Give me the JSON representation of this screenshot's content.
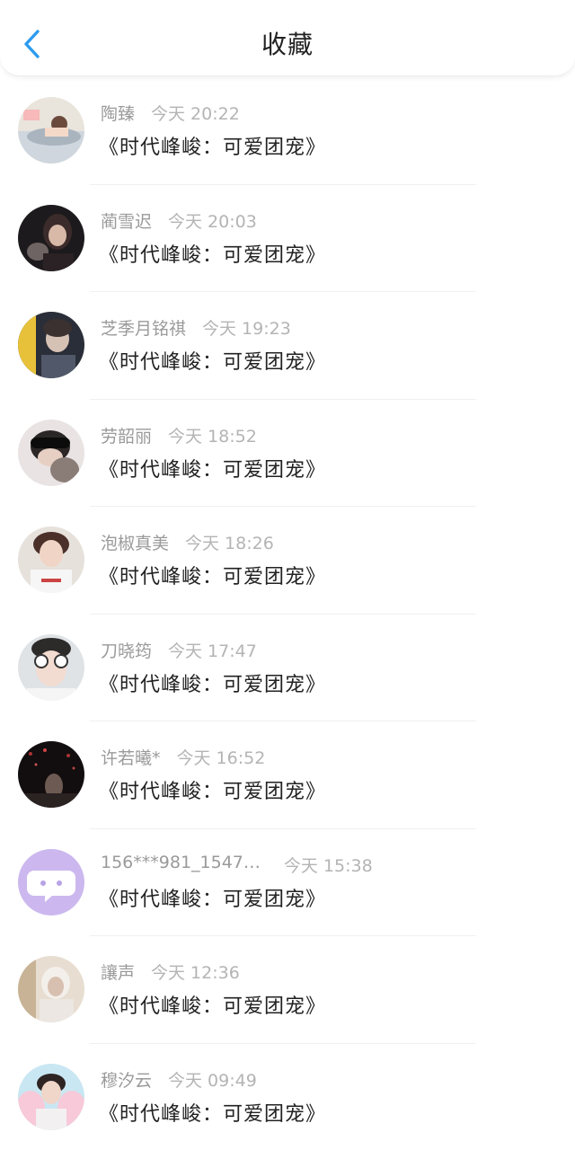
{
  "header": {
    "title": "收藏",
    "back_icon": "chevron-left-icon",
    "accent_color": "#2d9bf0"
  },
  "items": [
    {
      "name": "陶臻",
      "time": "今天 20:22",
      "book": "《时代峰峻：可爱团宠》"
    },
    {
      "name": "蔺雪迟",
      "time": "今天 20:03",
      "book": "《时代峰峻：可爱团宠》"
    },
    {
      "name": "芝季月铭祺",
      "time": "今天 19:23",
      "book": "《时代峰峻：可爱团宠》"
    },
    {
      "name": "劳韶丽",
      "time": "今天 18:52",
      "book": "《时代峰峻：可爱团宠》"
    },
    {
      "name": "泡椒真美",
      "time": "今天 18:26",
      "book": "《时代峰峻：可爱团宠》"
    },
    {
      "name": "刀晓筠",
      "time": "今天 17:47",
      "book": "《时代峰峻：可爱团宠》"
    },
    {
      "name": "许若曦*",
      "time": "今天 16:52",
      "book": "《时代峰峻：可爱团宠》"
    },
    {
      "name": "156***981_1547…",
      "time": "今天 15:38",
      "book": "《时代峰峻：可爱团宠》"
    },
    {
      "name": "讓声",
      "time": "今天 12:36",
      "book": "《时代峰峻：可爱团宠》"
    },
    {
      "name": "穆汐云",
      "time": "今天 09:49",
      "book": "《时代峰峻：可爱团宠》"
    }
  ]
}
